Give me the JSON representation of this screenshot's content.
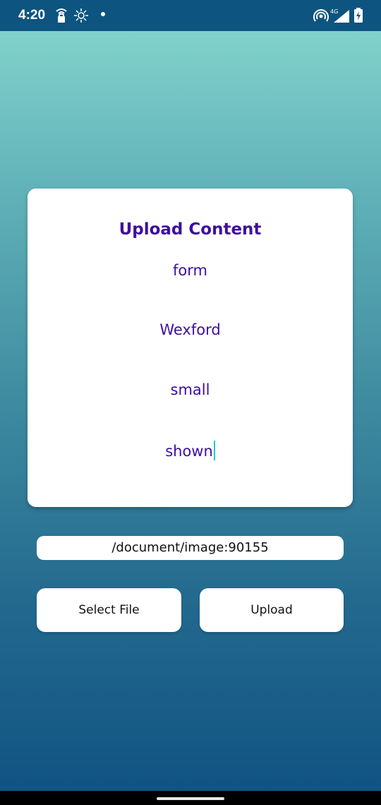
{
  "status_bar": {
    "time": "4:20",
    "icons": [
      "lock-antenna-icon",
      "brightness-icon",
      "notification-dot",
      "hotspot-icon",
      "signal-4g-icon",
      "battery-charging-icon"
    ],
    "network_label": "4G"
  },
  "card": {
    "title": "Upload Content",
    "fields": [
      "form",
      "Wexford",
      "small",
      "shown"
    ]
  },
  "file_path": "/document/image:90155",
  "buttons": {
    "select_file": "Select File",
    "upload": "Upload"
  },
  "colors": {
    "accent": "#3d0fa0",
    "caret": "#1fc7cf",
    "status_bar": "#0e5480",
    "gradient_top": "#86d8ce",
    "gradient_bottom": "#0f5282"
  }
}
